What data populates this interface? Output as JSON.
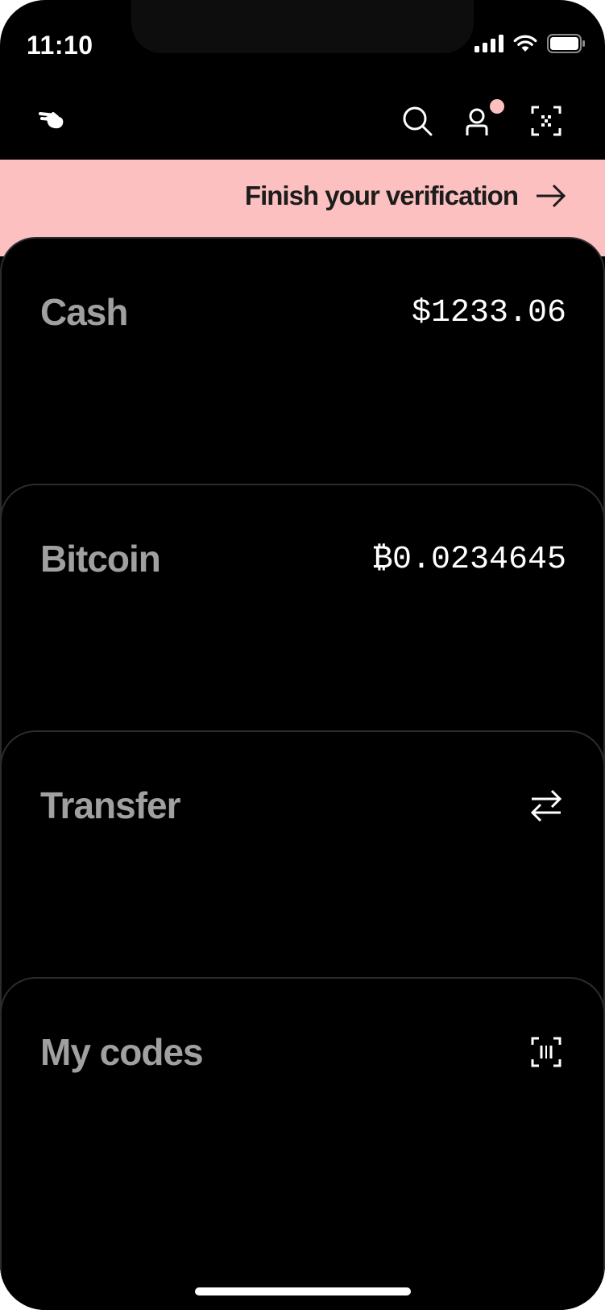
{
  "status_bar": {
    "time": "11:10",
    "icons": [
      "cellular-signal-icon",
      "wifi-icon",
      "battery-icon"
    ]
  },
  "header": {
    "logo_icon": "hand-logo-icon",
    "actions": [
      "search-icon",
      "profile-icon",
      "scan-qr-icon"
    ],
    "notification_dot_color": "#fcc0c0"
  },
  "banner": {
    "text": "Finish your verification",
    "icon": "arrow-right-icon",
    "background": "#fcc0c0"
  },
  "cards": {
    "cash": {
      "title": "Cash",
      "value": "$1233.06"
    },
    "bitcoin": {
      "title": "Bitcoin",
      "value": "₿0.0234645"
    },
    "transfer": {
      "title": "Transfer",
      "icon": "transfer-arrows-icon"
    },
    "my_codes": {
      "title": "My codes",
      "icon": "barcode-scan-icon"
    }
  }
}
